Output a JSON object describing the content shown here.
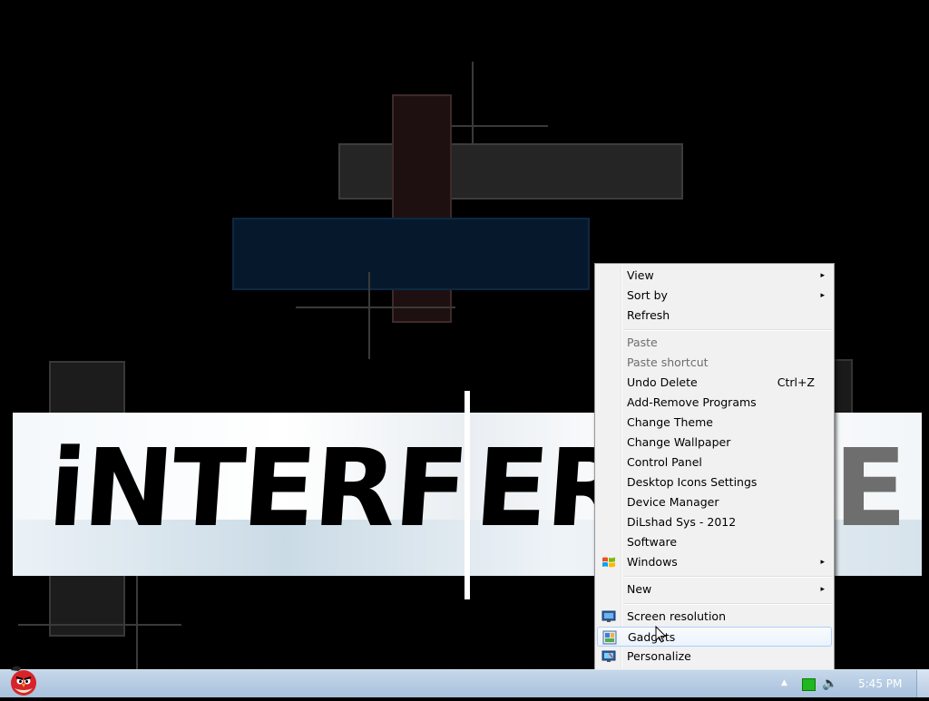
{
  "wallpaper": {
    "title_left": "iNTERF",
    "title_right_a": "ER",
    "title_right_b": "E"
  },
  "context_menu": {
    "items": [
      {
        "label": "View",
        "submenu": true
      },
      {
        "label": "Sort by",
        "submenu": true
      },
      {
        "label": "Refresh"
      },
      {
        "label": "Paste",
        "disabled": true
      },
      {
        "label": "Paste shortcut",
        "disabled": true
      },
      {
        "label": "Undo Delete",
        "shortcut": "Ctrl+Z"
      },
      {
        "label": "Add-Remove Programs"
      },
      {
        "label": "Change Theme"
      },
      {
        "label": "Change Wallpaper"
      },
      {
        "label": "Control Panel"
      },
      {
        "label": "Desktop Icons Settings"
      },
      {
        "label": "Device Manager"
      },
      {
        "label": "DiLshad Sys - 2012"
      },
      {
        "label": "Software"
      },
      {
        "label": "Windows",
        "submenu": true,
        "icon": "windows-logo-icon"
      },
      {
        "label": "New",
        "submenu": true
      },
      {
        "label": "Screen resolution",
        "icon": "monitor-icon"
      },
      {
        "label": "Gadgets",
        "icon": "gadgets-icon",
        "highlighted": true
      },
      {
        "label": "Personalize",
        "icon": "personalize-icon"
      }
    ],
    "submenu_arrow": "▸"
  },
  "taskbar": {
    "clock": "5:45 PM",
    "tray_arrow": "▲",
    "volume_glyph": "🔈",
    "start_icon": "angry-bird-icon"
  },
  "colors": {
    "menu_bg": "#f1f1f1",
    "taskbar": "#b6cbe3",
    "highlight_border": "#aecff7"
  }
}
